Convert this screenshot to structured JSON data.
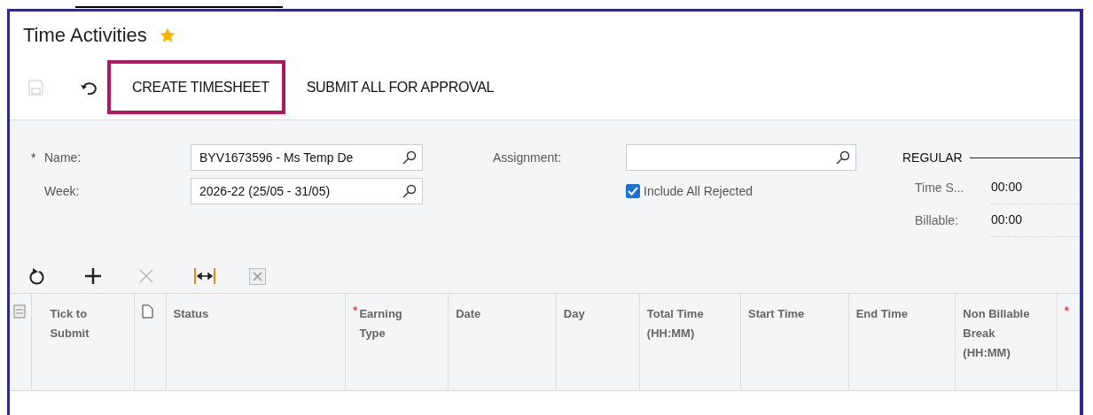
{
  "window": {
    "title": "Time Activities",
    "favorite": true
  },
  "toolbar": {
    "buttons": [
      {
        "kind": "save",
        "disabled": true
      },
      {
        "kind": "undo",
        "disabled": false
      },
      {
        "kind": "text",
        "label": "CREATE TIMESHEET",
        "highlighted": true
      },
      {
        "kind": "text",
        "label": "SUBMIT ALL FOR APPROVAL",
        "highlighted": false
      }
    ]
  },
  "form": {
    "name": {
      "label": "Name:",
      "mark": "*",
      "value": "BYV1673596 - Ms Temp De"
    },
    "week": {
      "label": "Week:",
      "value": "2026-22 (25/05 - 31/05)"
    },
    "assignment": {
      "label": "Assignment:"
    },
    "include_all_rejected": {
      "label": "Include All Rejected",
      "checked": true
    },
    "summary": {
      "title": "REGULAR",
      "rows": [
        {
          "label": "Time S...",
          "value": "00:00"
        },
        {
          "label": "Billable:",
          "value": "00:00"
        }
      ]
    }
  },
  "grid_toolbar": [
    {
      "kind": "refresh",
      "disabled": false
    },
    {
      "kind": "add",
      "disabled": false
    },
    {
      "kind": "delete",
      "disabled": true
    },
    {
      "kind": "fit",
      "disabled": false
    },
    {
      "kind": "excel",
      "disabled": true
    }
  ],
  "table": {
    "columns": [
      {
        "kind": "select-icon"
      },
      {
        "label": "Tick to Submit"
      },
      {
        "kind": "file-icon"
      },
      {
        "label": "Status"
      },
      {
        "label": "Earning Type",
        "mark": "*"
      },
      {
        "label": "Date"
      },
      {
        "label": "Day"
      },
      {
        "label": "Total Time (HH:MM)"
      },
      {
        "label": "Start Time"
      },
      {
        "label": "End Time"
      },
      {
        "label": "Non Billable Break (HH:MM)"
      },
      {
        "mark": "*"
      }
    ]
  }
}
